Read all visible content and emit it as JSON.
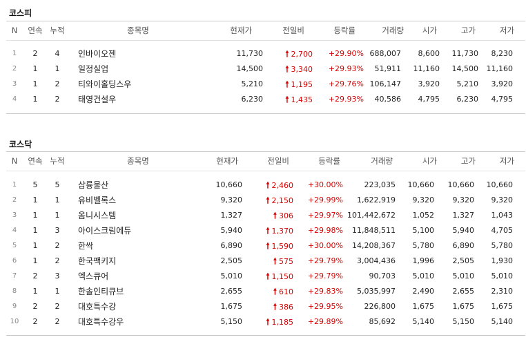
{
  "columns": {
    "n": "N",
    "streak": "연속",
    "total": "누적",
    "name": "종목명",
    "price": "현재가",
    "change": "전일비",
    "rate": "등락률",
    "volume": "거래량",
    "open": "시가",
    "high": "고가",
    "low": "저가"
  },
  "kospi": {
    "title": "코스피",
    "rows": [
      {
        "n": "1",
        "streak": "2",
        "total": "4",
        "name": "인바이오젠",
        "price": "11,730",
        "change": "2,700",
        "rate": "+29.90%",
        "volume": "688,007",
        "open": "8,600",
        "high": "11,730",
        "low": "8,230"
      },
      {
        "n": "2",
        "streak": "1",
        "total": "1",
        "name": "일정실업",
        "price": "14,500",
        "change": "3,340",
        "rate": "+29.93%",
        "volume": "51,911",
        "open": "11,160",
        "high": "14,500",
        "low": "11,160"
      },
      {
        "n": "3",
        "streak": "1",
        "total": "2",
        "name": "티와이홀딩스우",
        "price": "5,210",
        "change": "1,195",
        "rate": "+29.76%",
        "volume": "106,147",
        "open": "3,920",
        "high": "5,210",
        "low": "3,920"
      },
      {
        "n": "4",
        "streak": "1",
        "total": "2",
        "name": "태영건설우",
        "price": "6,230",
        "change": "1,435",
        "rate": "+29.93%",
        "volume": "40,586",
        "open": "4,795",
        "high": "6,230",
        "low": "4,795"
      }
    ]
  },
  "kosdaq": {
    "title": "코스닥",
    "rows": [
      {
        "n": "1",
        "streak": "5",
        "total": "5",
        "name": "삼륭물산",
        "price": "10,660",
        "change": "2,460",
        "rate": "+30.00%",
        "volume": "223,035",
        "open": "10,660",
        "high": "10,660",
        "low": "10,660"
      },
      {
        "n": "2",
        "streak": "1",
        "total": "1",
        "name": "유비벨록스",
        "price": "9,320",
        "change": "2,150",
        "rate": "+29.99%",
        "volume": "1,622,919",
        "open": "9,320",
        "high": "9,320",
        "low": "9,320"
      },
      {
        "n": "3",
        "streak": "1",
        "total": "1",
        "name": "옴니시스템",
        "price": "1,327",
        "change": "306",
        "rate": "+29.97%",
        "volume": "101,442,672",
        "open": "1,052",
        "high": "1,327",
        "low": "1,043"
      },
      {
        "n": "4",
        "streak": "1",
        "total": "3",
        "name": "아이스크림에듀",
        "price": "5,940",
        "change": "1,370",
        "rate": "+29.98%",
        "volume": "11,848,511",
        "open": "5,100",
        "high": "5,940",
        "low": "4,705"
      },
      {
        "n": "5",
        "streak": "1",
        "total": "2",
        "name": "한싹",
        "price": "6,890",
        "change": "1,590",
        "rate": "+30.00%",
        "volume": "14,208,367",
        "open": "5,780",
        "high": "6,890",
        "low": "5,780"
      },
      {
        "n": "6",
        "streak": "1",
        "total": "2",
        "name": "한국팩키지",
        "price": "2,505",
        "change": "575",
        "rate": "+29.79%",
        "volume": "3,004,436",
        "open": "1,996",
        "high": "2,505",
        "low": "1,930"
      },
      {
        "n": "7",
        "streak": "2",
        "total": "3",
        "name": "엑스큐어",
        "price": "5,010",
        "change": "1,150",
        "rate": "+29.79%",
        "volume": "90,703",
        "open": "5,010",
        "high": "5,010",
        "low": "5,010"
      },
      {
        "n": "8",
        "streak": "1",
        "total": "1",
        "name": "한솔인티큐브",
        "price": "2,655",
        "change": "610",
        "rate": "+29.83%",
        "volume": "5,035,997",
        "open": "2,490",
        "high": "2,655",
        "low": "2,310"
      },
      {
        "n": "9",
        "streak": "2",
        "total": "2",
        "name": "대호특수강",
        "price": "1,675",
        "change": "386",
        "rate": "+29.95%",
        "volume": "226,800",
        "open": "1,675",
        "high": "1,675",
        "low": "1,675"
      },
      {
        "n": "10",
        "streak": "2",
        "total": "2",
        "name": "대호특수강우",
        "price": "5,150",
        "change": "1,185",
        "rate": "+29.89%",
        "volume": "85,692",
        "open": "5,140",
        "high": "5,150",
        "low": "5,140"
      }
    ]
  },
  "icons": {
    "change_up": "up-arrow-icon",
    "up_glyph": "🠕"
  },
  "colors": {
    "up": "#d60000",
    "index": "#888888"
  }
}
